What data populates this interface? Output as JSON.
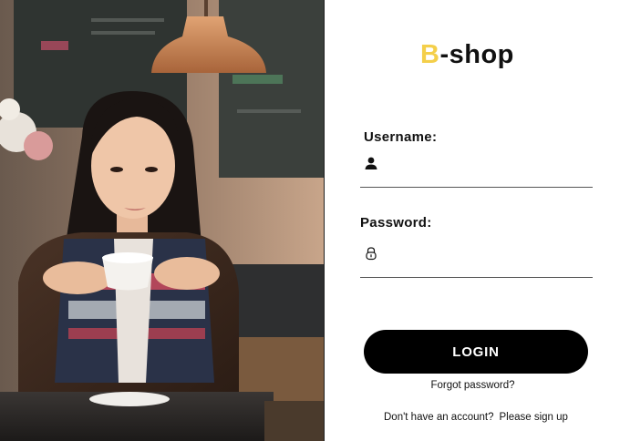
{
  "brand": {
    "accent_letter": "B",
    "rest": "-shop",
    "accent_color": "#f4cf4a"
  },
  "form": {
    "username_label": "Username:",
    "password_label": "Password:",
    "username_value": "",
    "password_value": "",
    "username_icon": "user-icon",
    "password_icon": "lock-icon"
  },
  "actions": {
    "login_label": "LOGIN",
    "forgot_label": "Forgot password?",
    "signup_prompt": "Don't have an account?",
    "signup_link": "Please sign up"
  },
  "colors": {
    "button_bg": "#000000",
    "panel_bg": "#ffffff",
    "text": "#111111"
  }
}
